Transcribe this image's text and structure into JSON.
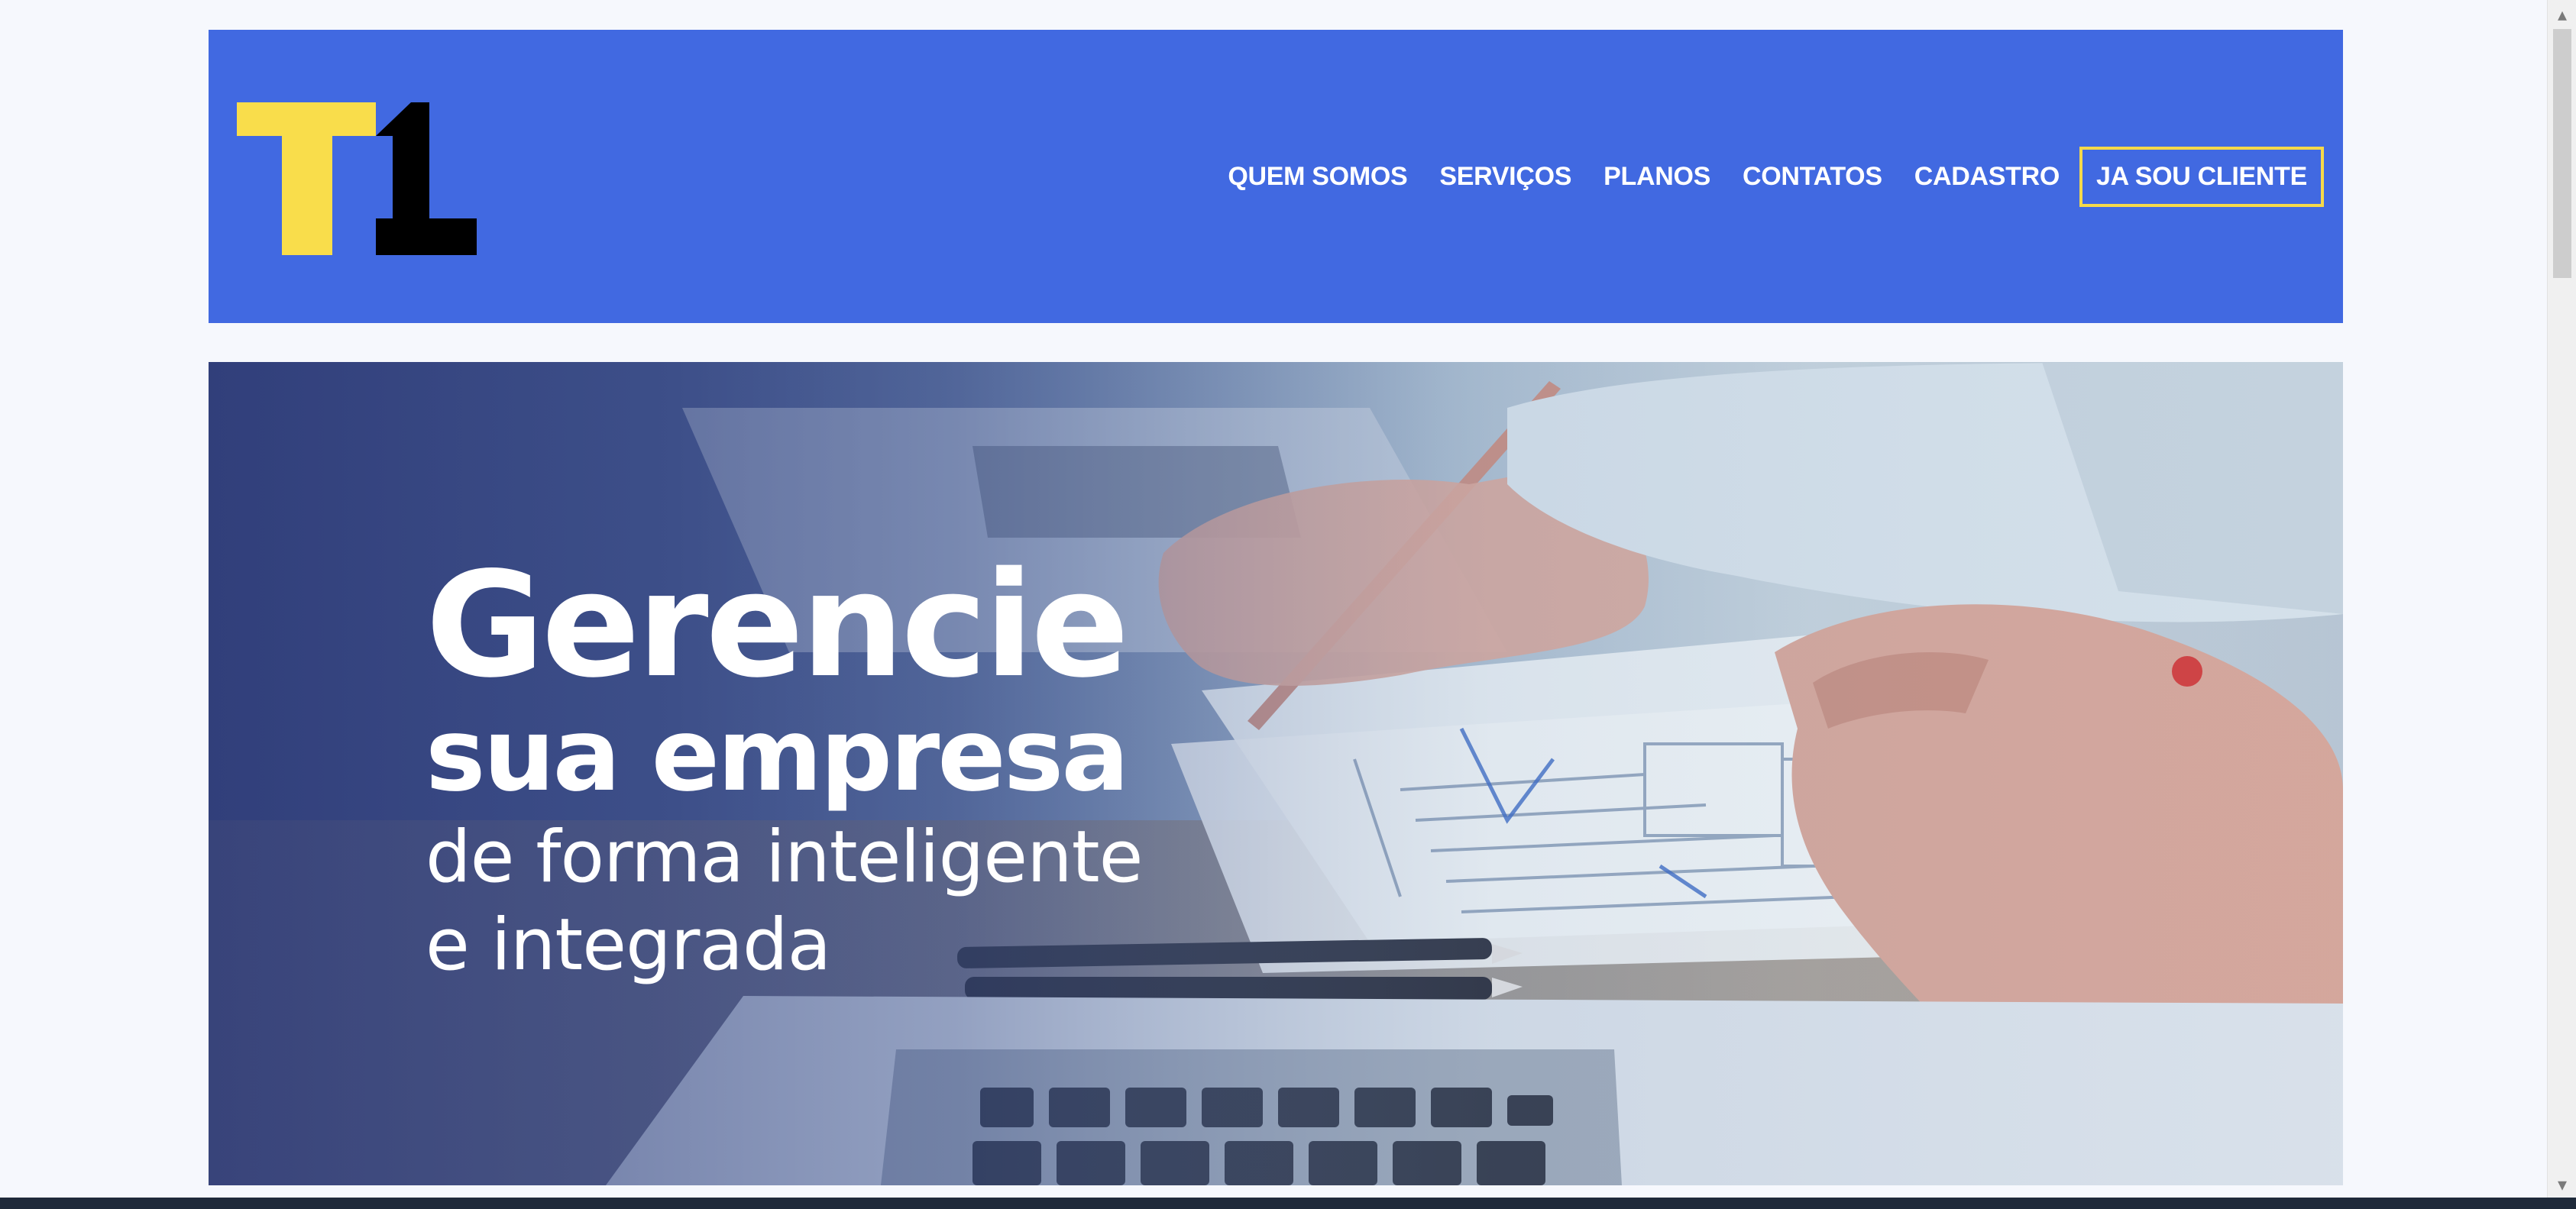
{
  "brand": {
    "logo_text": "T1",
    "colors": {
      "header_bg": "#4169e1",
      "logo_yellow": "#f9dd4b",
      "logo_black": "#000000",
      "button_border": "#f5d94a"
    }
  },
  "nav": {
    "items": [
      {
        "label": "QUEM SOMOS"
      },
      {
        "label": "SERVIÇOS"
      },
      {
        "label": "PLANOS"
      },
      {
        "label": "CONTATOS"
      },
      {
        "label": "CADASTRO"
      }
    ],
    "client_button": "JA SOU CLIENTE"
  },
  "hero": {
    "line1": "Gerencie",
    "line2": "sua empresa",
    "line3": "de forma inteligente",
    "line4": "e integrada",
    "image_desc_icon": "office-desk-photo"
  },
  "scrollbar": {
    "up_icon": "chevron-up-icon",
    "down_icon": "chevron-down-icon"
  }
}
